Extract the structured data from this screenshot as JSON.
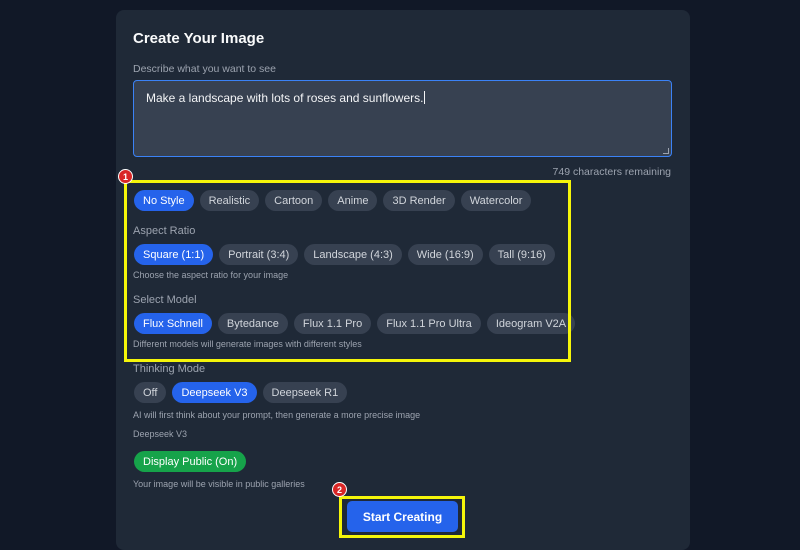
{
  "title": "Create Your Image",
  "prompt": {
    "label": "Describe what you want to see",
    "value": "Make a landscape with lots of roses and sunflowers.",
    "chars_remaining": "749 characters remaining"
  },
  "styles": {
    "options": [
      "No Style",
      "Realistic",
      "Cartoon",
      "Anime",
      "3D Render",
      "Watercolor"
    ],
    "selected": "No Style"
  },
  "aspect": {
    "label": "Aspect Ratio",
    "options": [
      "Square (1:1)",
      "Portrait (3:4)",
      "Landscape (4:3)",
      "Wide (16:9)",
      "Tall (9:16)"
    ],
    "selected": "Square (1:1)",
    "hint": "Choose the aspect ratio for your image"
  },
  "model": {
    "label": "Select Model",
    "options": [
      "Flux Schnell",
      "Bytedance",
      "Flux 1.1 Pro",
      "Flux 1.1 Pro Ultra",
      "Ideogram V2A"
    ],
    "selected": "Flux Schnell",
    "hint": "Different models will generate images with different styles"
  },
  "thinking": {
    "label": "Thinking Mode",
    "options": [
      "Off",
      "Deepseek V3",
      "Deepseek R1"
    ],
    "selected": "Deepseek V3",
    "hint": "AI will first think about your prompt, then generate a more precise image",
    "current": "Deepseek V3"
  },
  "public": {
    "toggle_label": "Display Public (On)",
    "hint": "Your image will be visible in public galleries"
  },
  "cta_label": "Start Creating",
  "annotations": {
    "badge_1": "1",
    "badge_2": "2",
    "highlight_color": "#f5f50a",
    "badge_color": "#d92626"
  },
  "colors": {
    "accent": "#2563eb",
    "success": "#16a34a",
    "panel": "#1f2937",
    "background": "#111827"
  }
}
